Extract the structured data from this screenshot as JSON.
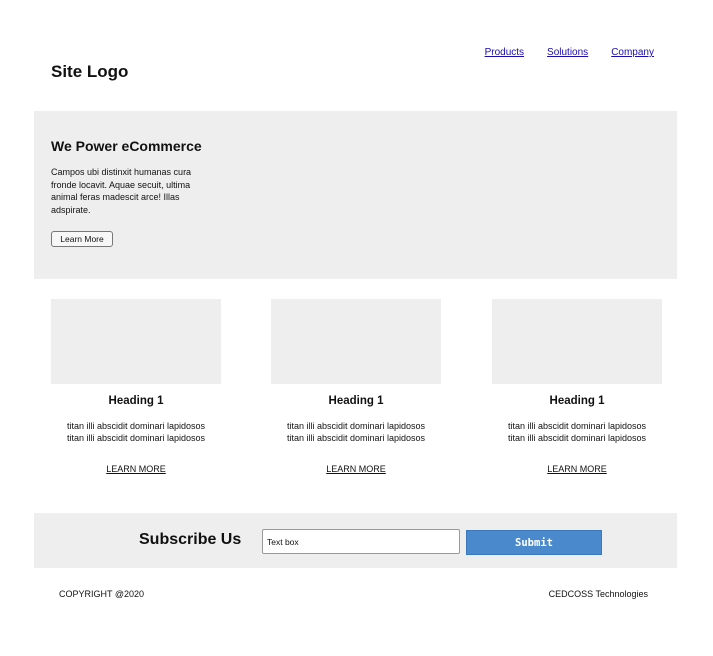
{
  "header": {
    "logo": "Site Logo",
    "nav": [
      "Products",
      "Solutions",
      "Company"
    ]
  },
  "hero": {
    "title": "We Power eCommerce",
    "text": "Campos ubi distinxit humanas cura fronde locavit. Aquae secuit, ultima animal feras madescit arce! Illas adspirate.",
    "button_label": "Learn More"
  },
  "cards": [
    {
      "heading": "Heading 1",
      "lines": [
        "titan illi abscidit dominari lapidosos",
        "titan illi abscidit dominari lapidosos"
      ],
      "link": "LEARN MORE"
    },
    {
      "heading": "Heading 1",
      "lines": [
        "titan illi abscidit dominari lapidosos",
        "titan illi abscidit dominari lapidosos"
      ],
      "link": "LEARN MORE"
    },
    {
      "heading": "Heading 1",
      "lines": [
        "titan illi abscidit dominari lapidosos",
        "titan illi abscidit dominari lapidosos"
      ],
      "link": "LEARN MORE"
    }
  ],
  "subscribe": {
    "title": "Subscribe Us",
    "input_value": "Text box",
    "submit_label": "Submit",
    "submit_color": "#4a8acc"
  },
  "footer": {
    "copyright": "COPYRIGHT @2020",
    "company": "CEDCOSS Technologies"
  }
}
